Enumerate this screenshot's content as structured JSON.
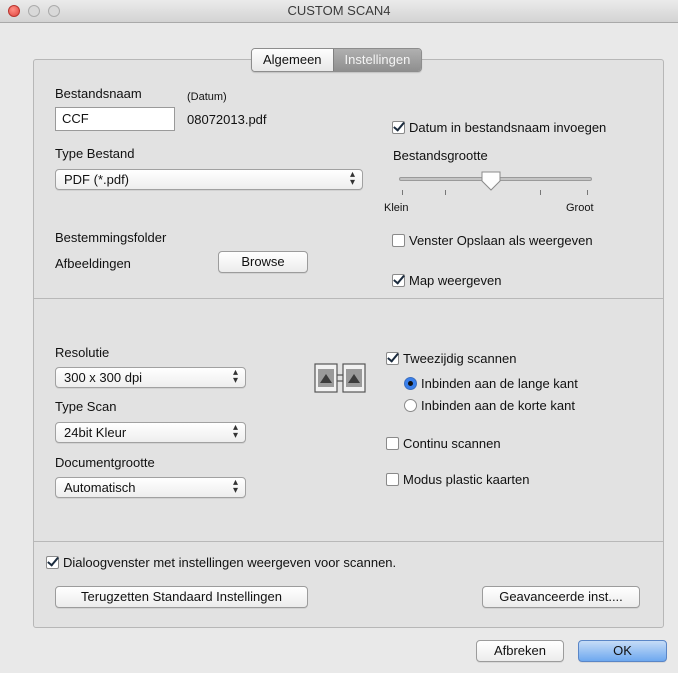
{
  "window": {
    "title": "CUSTOM SCAN4"
  },
  "tabs": [
    {
      "label": "Algemeen",
      "selected": false
    },
    {
      "label": "Instellingen",
      "selected": true
    }
  ],
  "file": {
    "name_label": "Bestandsnaam",
    "date_hint": "(Datum)",
    "name_value": "CCF",
    "date_value": "08072013.pdf",
    "type_label": "Type Bestand",
    "type_value": "PDF (*.pdf)"
  },
  "options_top": {
    "insert_date": {
      "label": "Datum in bestandsnaam invoegen",
      "checked": true
    },
    "size_label": "Bestandsgrootte",
    "size_slider": {
      "min_label": "Klein",
      "max_label": "Groot",
      "position_fraction": 0.49
    },
    "show_save_window": {
      "label": "Venster Opslaan als weergeven",
      "checked": false
    },
    "show_folder": {
      "label": "Map weergeven",
      "checked": true
    }
  },
  "destination": {
    "label": "Bestemmingsfolder",
    "folder": "Afbeeldingen",
    "browse_label": "Browse"
  },
  "scan": {
    "resolution_label": "Resolutie",
    "resolution_value": "300 x 300 dpi",
    "type_label": "Type Scan",
    "type_value": "24bit Kleur",
    "docsize_label": "Documentgrootte",
    "docsize_value": "Automatisch"
  },
  "duplex": {
    "label": "Tweezijdig scannen",
    "checked": true,
    "long_edge": {
      "label": "Inbinden aan de lange kant",
      "selected": true
    },
    "short_edge": {
      "label": "Inbinden aan de korte kant",
      "selected": false
    },
    "icon": "duplex-scan-icon"
  },
  "continuous": {
    "label": "Continu scannen",
    "checked": false
  },
  "plastic_card": {
    "label": "Modus plastic kaarten",
    "checked": false
  },
  "show_dialog": {
    "label": "Dialoogvenster met instellingen weergeven voor scannen.",
    "checked": true
  },
  "buttons": {
    "reset": "Terugzetten Standaard Instellingen",
    "advanced": "Geavanceerde inst....",
    "cancel": "Afbreken",
    "ok": "OK"
  },
  "colors": {
    "default_button": "#6ea8ef",
    "radio_selected": "#3a80ec",
    "close_light": "#e0443e"
  }
}
